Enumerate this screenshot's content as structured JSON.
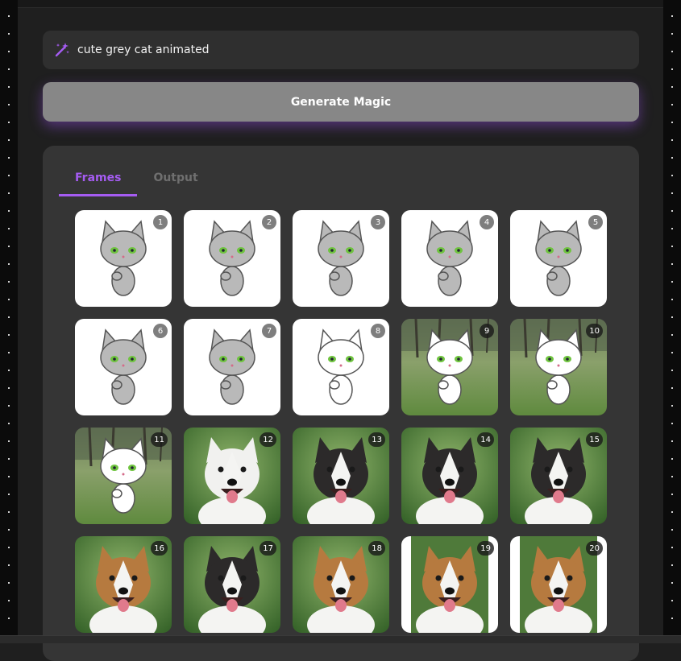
{
  "prompt": {
    "icon": "magic-wand-icon",
    "value": "cute grey cat animated"
  },
  "generate": {
    "label": "Generate Magic"
  },
  "tabs": [
    {
      "label": "Frames",
      "active": true
    },
    {
      "label": "Output",
      "active": false
    }
  ],
  "frames": [
    {
      "number": "1",
      "kind": "cat-grey",
      "bg": "white"
    },
    {
      "number": "2",
      "kind": "cat-grey",
      "bg": "white"
    },
    {
      "number": "3",
      "kind": "cat-grey",
      "bg": "white"
    },
    {
      "number": "4",
      "kind": "cat-grey",
      "bg": "white"
    },
    {
      "number": "5",
      "kind": "cat-grey",
      "bg": "white"
    },
    {
      "number": "6",
      "kind": "cat-grey",
      "bg": "white"
    },
    {
      "number": "7",
      "kind": "cat-grey",
      "bg": "white"
    },
    {
      "number": "8",
      "kind": "cat-white",
      "bg": "white"
    },
    {
      "number": "9",
      "kind": "cat-white",
      "bg": "park"
    },
    {
      "number": "10",
      "kind": "cat-white",
      "bg": "park"
    },
    {
      "number": "11",
      "kind": "cat-white",
      "bg": "park"
    },
    {
      "number": "12",
      "kind": "dog-white",
      "bg": "green"
    },
    {
      "number": "13",
      "kind": "dog-tri",
      "bg": "green"
    },
    {
      "number": "14",
      "kind": "dog-tri",
      "bg": "green"
    },
    {
      "number": "15",
      "kind": "dog-tri",
      "bg": "green"
    },
    {
      "number": "16",
      "kind": "dog-tan",
      "bg": "green"
    },
    {
      "number": "17",
      "kind": "dog-tri",
      "bg": "green"
    },
    {
      "number": "18",
      "kind": "dog-tan",
      "bg": "green"
    },
    {
      "number": "19",
      "kind": "dog-tan",
      "bg": "portrait"
    },
    {
      "number": "20",
      "kind": "dog-tan",
      "bg": "portrait"
    }
  ],
  "colors": {
    "accent": "#a55cf2",
    "button": "#878787",
    "panel": "#353535"
  }
}
